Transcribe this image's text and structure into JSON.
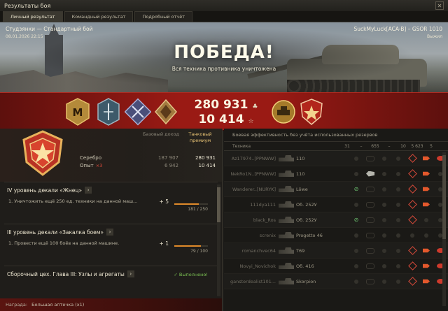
{
  "window": {
    "title": "Результаты боя",
    "close": "✕"
  },
  "tabs": [
    "Личный результат",
    "Командный результат",
    "Подробный отчёт"
  ],
  "battle": {
    "map_mode": "Студзянки — Стандартный бой",
    "date": "08.01.2026 22:15",
    "player": "SuckMyLuck[ACA-B] – GSOR 1010",
    "status": "Выжил",
    "result": "ПОБЕДА!",
    "subtitle": "Вся техника противника уничтожена"
  },
  "totals": {
    "credits": "280 931",
    "xp": "10 414"
  },
  "rank": {
    "columns": {
      "base": "Базовый доход",
      "premium": "Танковый премиум"
    },
    "credits_label": "Серебро",
    "xp_label": "Опыт",
    "xp_mult": "×3",
    "credits_base": "187 907",
    "credits_prem": "280 931",
    "xp_base": "6 942",
    "xp_prem": "10 414"
  },
  "missions": [
    {
      "title": "IV уровень декали «Жнец»",
      "task": "1. Уничтожить ещё 250 ед. техники на данной маш...",
      "plus": "+ 5",
      "progress": "181 / 250",
      "fill": 0.72
    },
    {
      "title": "III уровень декали «Закалка боем»",
      "task": "1. Провести ещё 100 боёв на данной машине.",
      "plus": "+ 1",
      "progress": "79 / 100",
      "fill": 0.79
    },
    {
      "title": "Сборочный цех. Глава III: Узлы и агрегаты",
      "done": "✓ Выполнено!"
    }
  ],
  "reward": {
    "label": "Награда:",
    "value": "Большая аптечка (x1)"
  },
  "efficiency": {
    "header": "Боевая эффективность без учёта использованных резервов",
    "columns": {
      "vehicle": "Техника",
      "c1": "31",
      "c2": "–",
      "c3": "655",
      "c4": "–",
      "c5": "10",
      "c6": "5 623",
      "c7": "5"
    },
    "rows": [
      {
        "player": "Az17974..[PPNWW]",
        "tank": "110"
      },
      {
        "player": "NekRo1N..[PPNWW]",
        "tank": "110"
      },
      {
        "player": "Wanderer..[NURYK]",
        "tank": "Löwe"
      },
      {
        "player": "111dya111",
        "tank": "Об. 252У"
      },
      {
        "player": "black_Ros",
        "tank": "Об. 252У"
      },
      {
        "player": "screnix",
        "tank": "Progetto 46"
      },
      {
        "player": "romanchvec64",
        "tank": "T69"
      },
      {
        "player": "Novyi_Novichok",
        "tank": "Об. 416"
      },
      {
        "player": "gansterdealist101...",
        "tank": "Skorpion"
      }
    ]
  },
  "colors": {
    "band": "#9a1a14",
    "accent": "#e08a2a",
    "done": "#7dc454"
  }
}
